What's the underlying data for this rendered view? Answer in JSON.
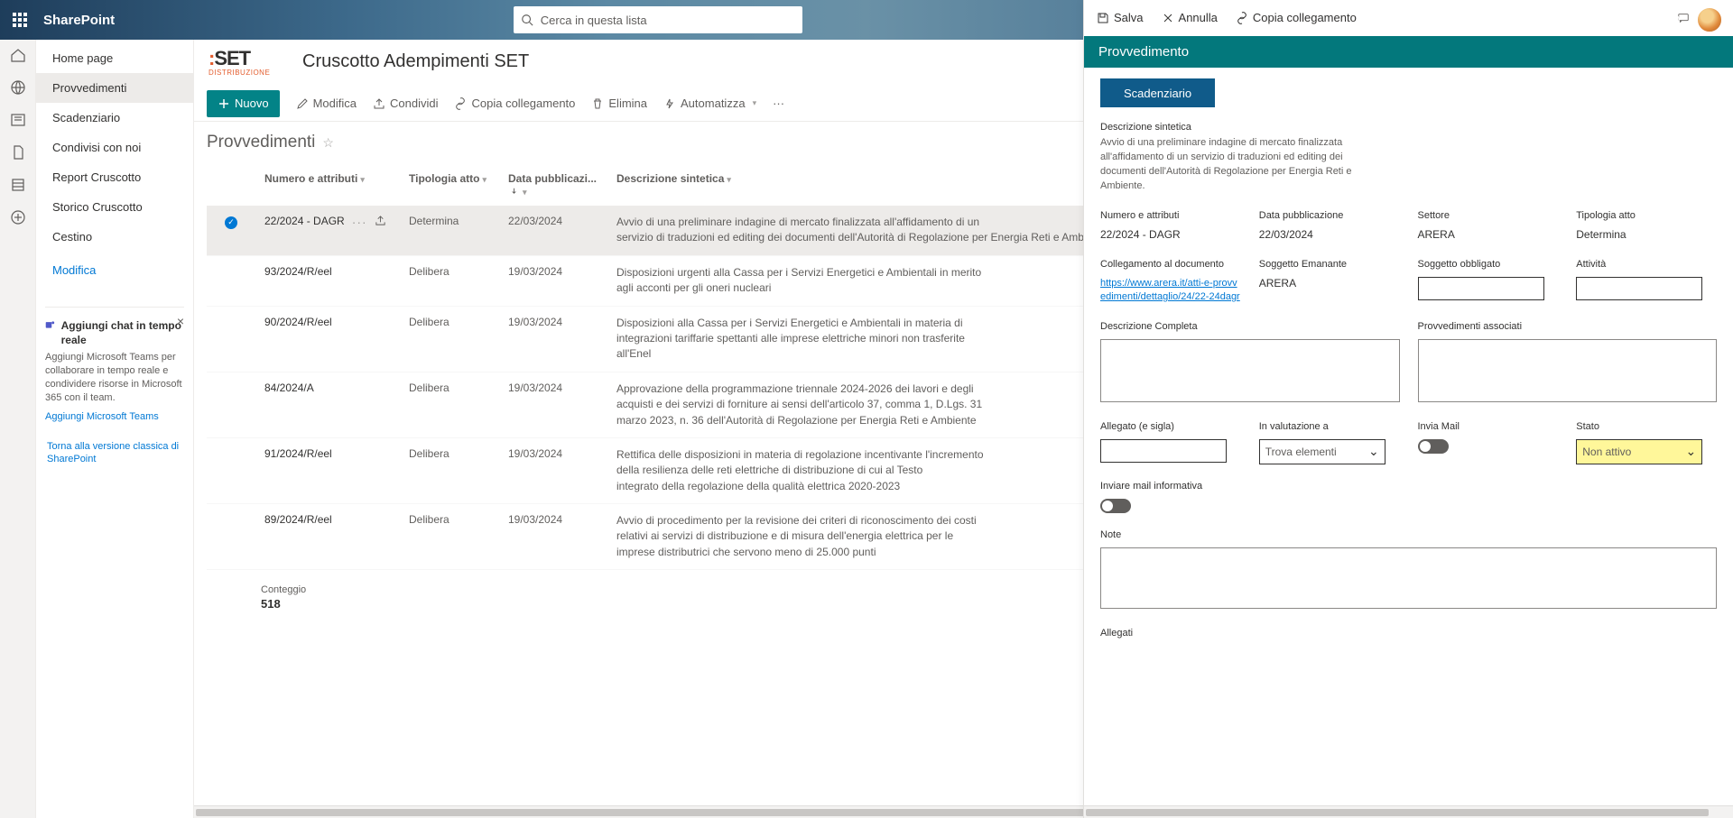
{
  "suite": {
    "title": "SharePoint",
    "search_placeholder": "Cerca in questa lista"
  },
  "site": {
    "logo_main": "SET",
    "logo_sub": "DISTRIBUZIONE",
    "title": "Cruscotto Adempimenti SET"
  },
  "nav": {
    "items": [
      "Home page",
      "Provvedimenti",
      "Scadenziario",
      "Condivisi con noi",
      "Report Cruscotto",
      "Storico Cruscotto",
      "Cestino"
    ],
    "active_index": 1,
    "edit_label": "Modifica"
  },
  "promo": {
    "title": "Aggiungi chat in tempo reale",
    "body": "Aggiungi Microsoft Teams per collaborare in tempo reale e condividere risorse in Microsoft 365 con il team.",
    "link": "Aggiungi Microsoft Teams"
  },
  "classic_link": "Torna alla versione classica di SharePoint",
  "cmdbar": {
    "new": "Nuovo",
    "edit": "Modifica",
    "share": "Condividi",
    "copylink": "Copia collegamento",
    "delete": "Elimina",
    "automate": "Automatizza"
  },
  "list": {
    "title": "Provvedimenti",
    "col_num": "Numero e attributi",
    "col_tipo": "Tipologia atto",
    "col_data": "Data pubblicazi...",
    "col_desc": "Descrizione sintetica",
    "count_label": "Conteggio",
    "count_value": "518",
    "rows": [
      {
        "num": "22/2024 - DAGR",
        "tipo": "Determina",
        "data": "22/03/2024",
        "desc": "Avvio di una preliminare indagine di mercato finalizzata all'affidamento di un\nservizio di traduzioni ed editing dei documenti dell'Autorità di Regolazione per Energia Reti e Ambiente.",
        "selected": true
      },
      {
        "num": "93/2024/R/eel",
        "tipo": "Delibera",
        "data": "19/03/2024",
        "desc": "Disposizioni urgenti alla Cassa per i Servizi Energetici e Ambientali in merito\nagli acconti per gli oneri nucleari"
      },
      {
        "num": "90/2024/R/eel",
        "tipo": "Delibera",
        "data": "19/03/2024",
        "desc": "Disposizioni alla Cassa per i Servizi Energetici e Ambientali in materia di\nintegrazioni tariffarie spettanti alle imprese elettriche minori non trasferite\nall'Enel"
      },
      {
        "num": "84/2024/A",
        "tipo": "Delibera",
        "data": "19/03/2024",
        "desc": "Approvazione della programmazione triennale 2024-2026 dei lavori e degli\nacquisti e dei servizi di forniture ai sensi dell'articolo 37, comma 1, D.Lgs. 31\nmarzo 2023, n. 36 dell'Autorità di Regolazione per Energia Reti e Ambiente"
      },
      {
        "num": "91/2024/R/eel",
        "tipo": "Delibera",
        "data": "19/03/2024",
        "desc": "Rettifica delle disposizioni in materia di regolazione incentivante l'incremento\ndella resilienza delle reti elettriche di distribuzione di cui al Testo\nintegrato della regolazione della qualità elettrica 2020-2023"
      },
      {
        "num": "89/2024/R/eel",
        "tipo": "Delibera",
        "data": "19/03/2024",
        "desc": "Avvio di procedimento per la revisione dei criteri di riconoscimento dei costi\nrelativi ai servizi di distribuzione e di misura dell'energia elettrica per le\nimprese distributrici che servono meno di 25.000 punti"
      }
    ]
  },
  "panel": {
    "save": "Salva",
    "cancel": "Annulla",
    "copylink": "Copia collegamento",
    "title": "Provvedimento",
    "scadenziario": "Scadenziario",
    "desc_label": "Descrizione sintetica",
    "desc_text": "Avvio di una preliminare indagine di mercato finalizzata all'affidamento di un servizio di traduzioni ed editing dei documenti dell'Autorità di Regolazione per Energia Reti e Ambiente.",
    "fields": {
      "numero_label": "Numero e attributi",
      "numero_val": "22/2024 - DAGR",
      "data_label": "Data pubblicazione",
      "data_val": "22/03/2024",
      "settore_label": "Settore",
      "settore_val": "ARERA",
      "tipologia_label": "Tipologia atto",
      "tipologia_val": "Determina",
      "colleg_label": "Collegamento al documento",
      "colleg_val": "https://www.arera.it/atti-e-provvedimenti/dettaglio/24/22-24dagr",
      "sogg_em_label": "Soggetto Emanante",
      "sogg_em_val": "ARERA",
      "sogg_ob_label": "Soggetto obbligato",
      "attivita_label": "Attività",
      "desc_comp_label": "Descrizione Completa",
      "prov_ass_label": "Provvedimenti associati",
      "allegato_label": "Allegato (e sigla)",
      "inval_label": "In valutazione a",
      "inval_val": "Trova elementi",
      "invia_label": "Invia Mail",
      "stato_label": "Stato",
      "stato_val": "Non attivo",
      "inviare_label": "Inviare mail informativa",
      "note_label": "Note",
      "allegati_label": "Allegati"
    }
  }
}
